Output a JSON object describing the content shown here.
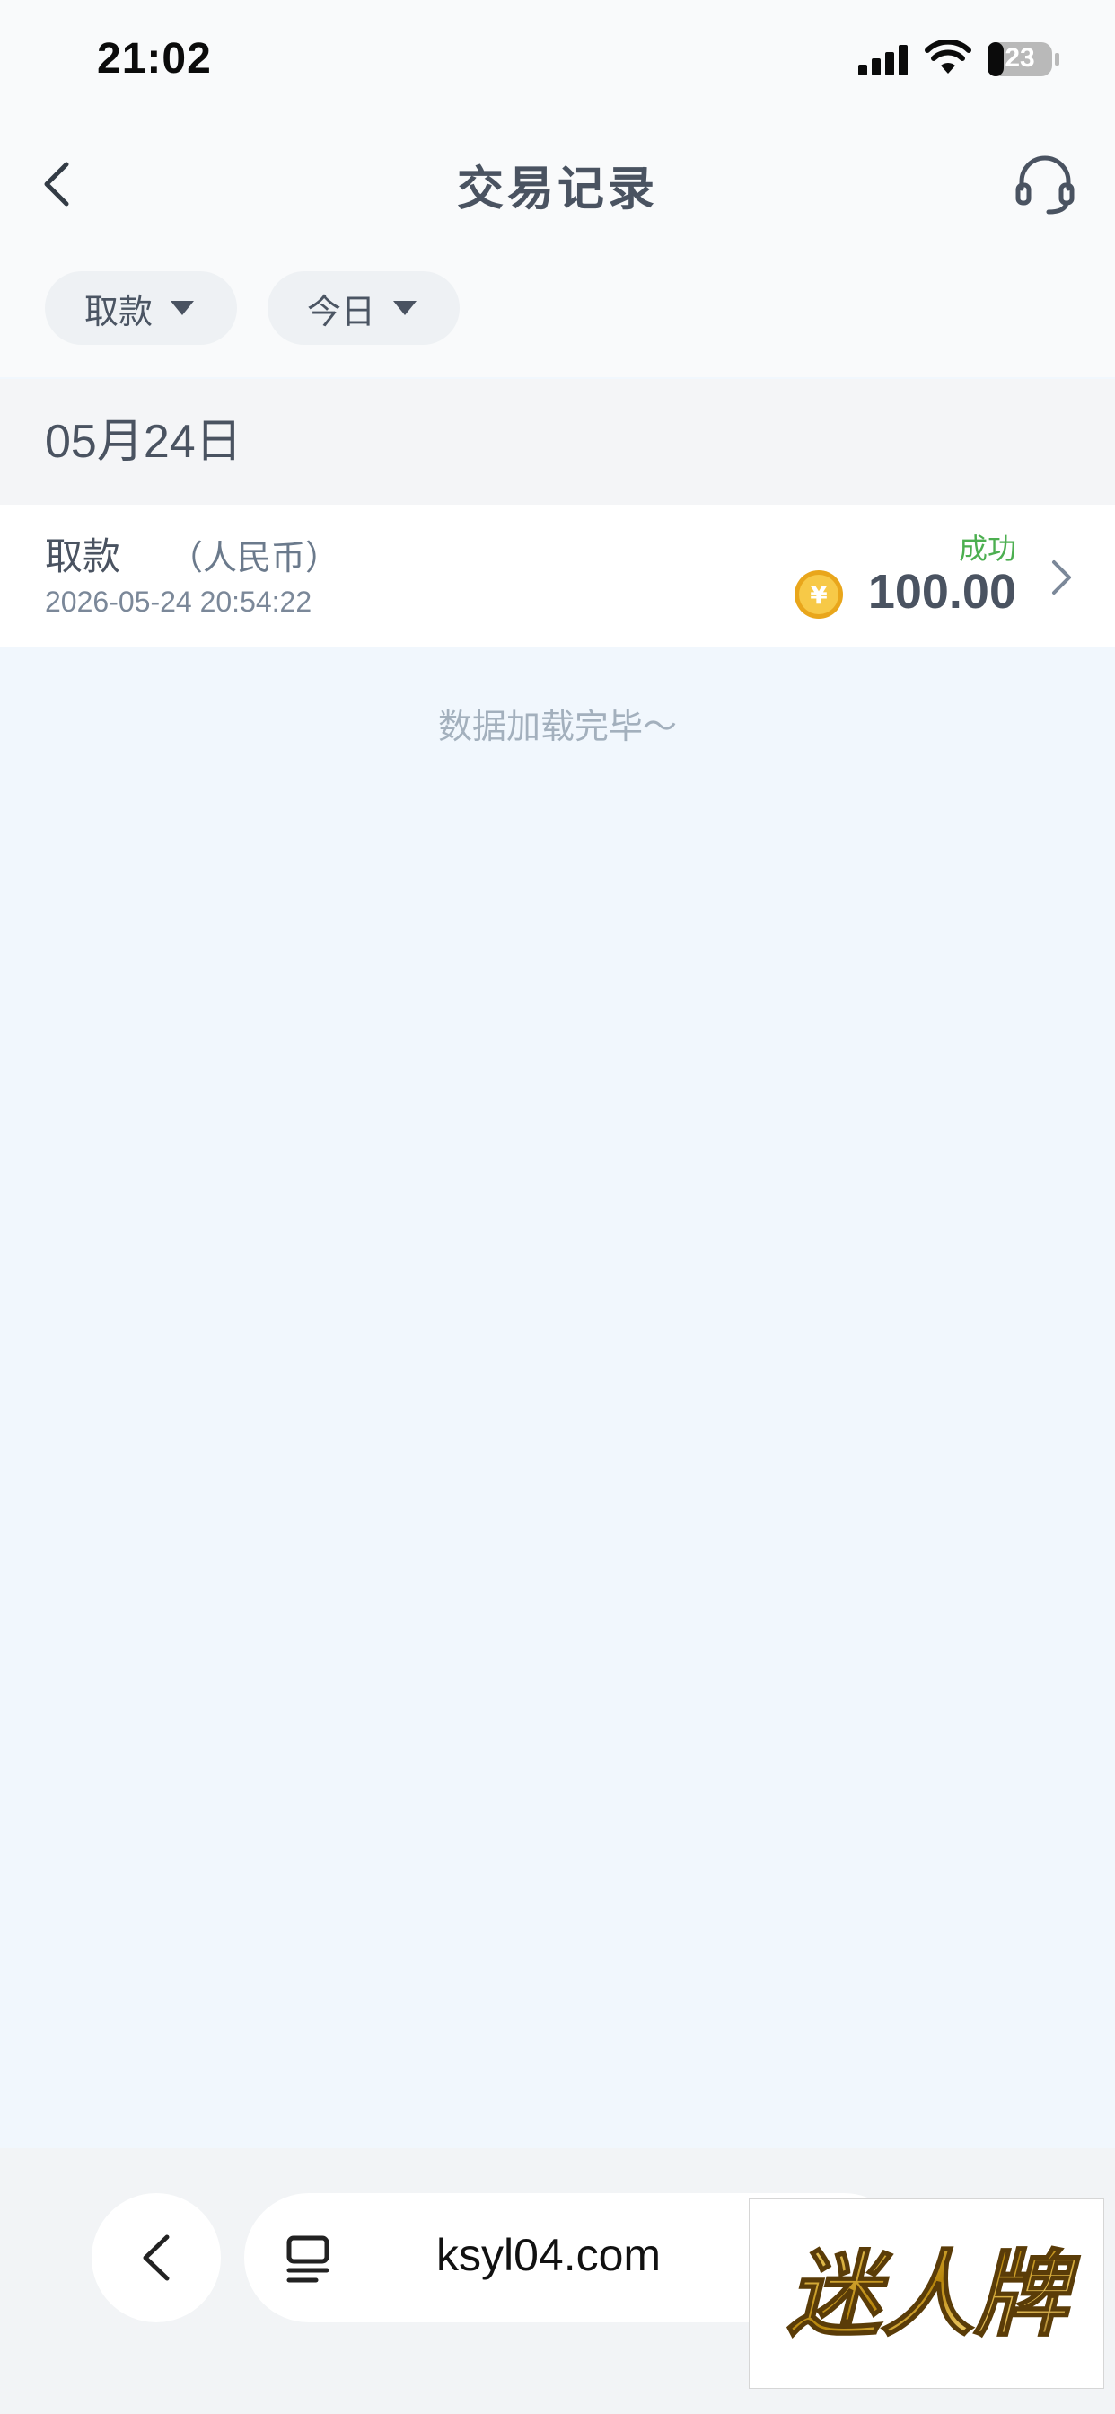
{
  "status_bar": {
    "time": "21:02",
    "battery": "23"
  },
  "header": {
    "title": "交易记录"
  },
  "filters": [
    {
      "label": "取款"
    },
    {
      "label": "今日"
    }
  ],
  "date_group": {
    "label": "05月24日"
  },
  "transaction": {
    "type": "取款",
    "currency": "（人民币）",
    "datetime": "2026-05-24 20:54:22",
    "status": "成功",
    "amount": "100.00",
    "coin_symbol": "¥"
  },
  "list_end_text": "数据加载完毕～",
  "browser": {
    "url": "ksyl04.com"
  },
  "watermark": {
    "text": "迷人牌"
  },
  "colors": {
    "success": "#4caf50",
    "text_primary": "#4a5361",
    "page_bg": "#f1f7fd",
    "coin": "#f3b723"
  }
}
